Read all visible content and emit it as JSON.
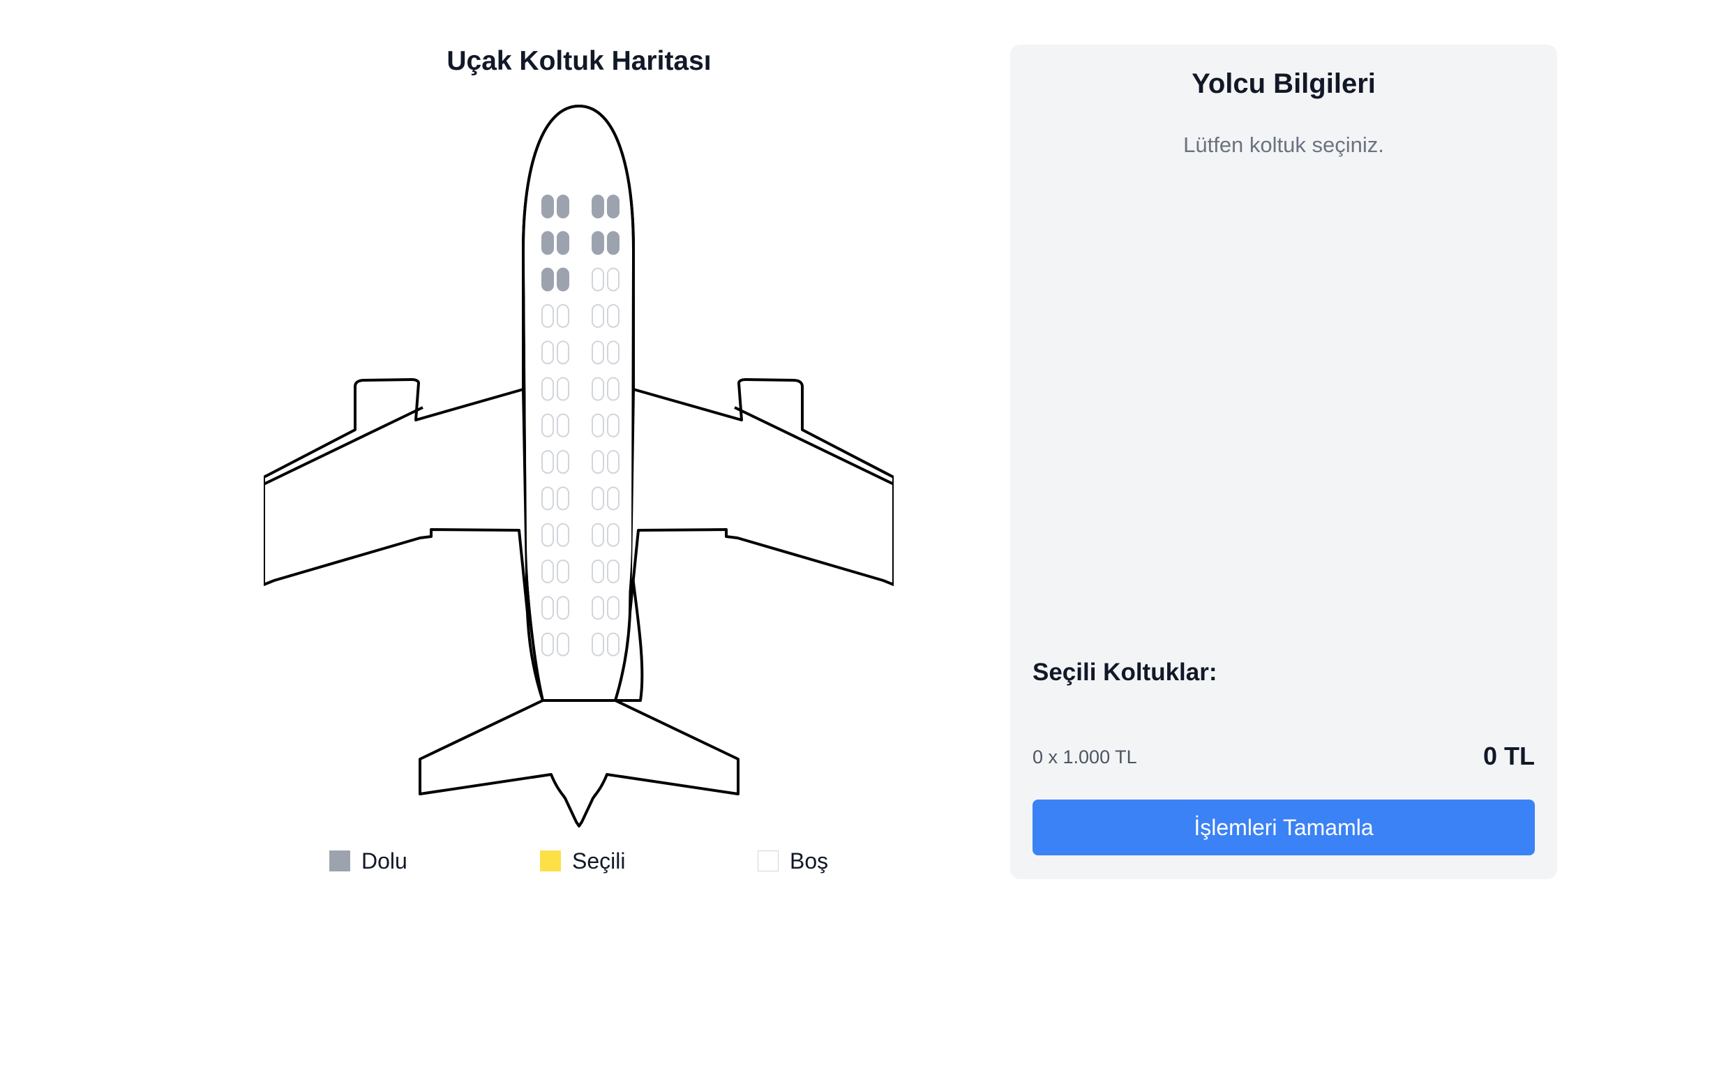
{
  "seat_map": {
    "title": "Uçak Koltuk Haritası",
    "rows": 13,
    "columns_per_side": 2,
    "occupied_seats": [
      "1A",
      "1B",
      "1C",
      "1D",
      "2A",
      "2B",
      "2C",
      "2D",
      "3A",
      "3B"
    ],
    "selected_seats": [],
    "legend": [
      {
        "key": "occupied",
        "label": "Dolu",
        "color": "#9ca3af"
      },
      {
        "key": "selected",
        "label": "Seçili",
        "color": "#fde047"
      },
      {
        "key": "empty",
        "label": "Boş",
        "color": "#ffffff"
      }
    ]
  },
  "panel": {
    "title": "Yolcu Bilgileri",
    "message": "Lütfen koltuk seçiniz.",
    "selected_heading": "Seçili Koltuklar:",
    "price_formula": "0 x 1.000 TL",
    "total": "0 TL",
    "complete_label": "İşlemleri Tamamla"
  },
  "colors": {
    "panel_bg": "#f3f4f6",
    "accent": "#3b82f6",
    "seat_outline": "#d1d5db",
    "muted_text": "#6b7280"
  }
}
